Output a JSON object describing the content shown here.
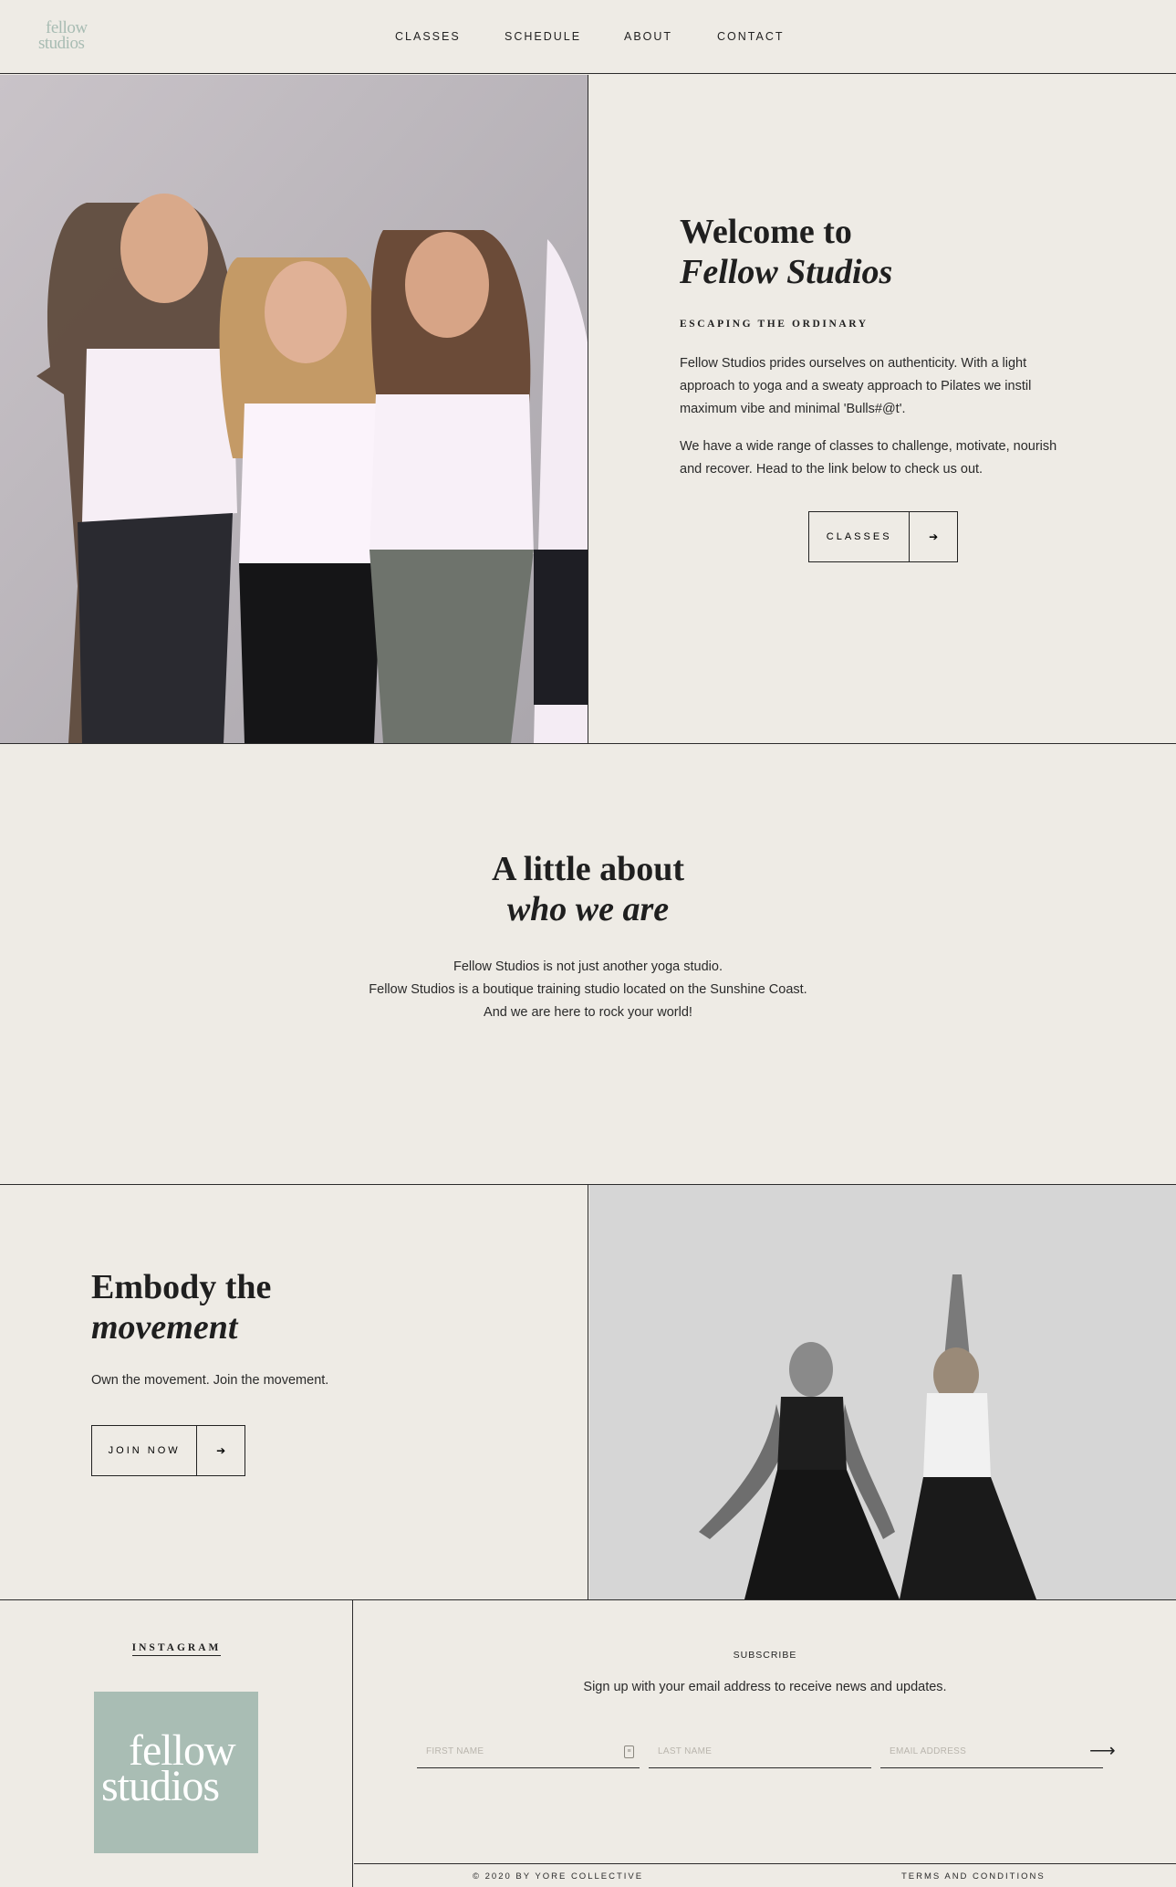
{
  "header": {
    "logo_line1": "fellow",
    "logo_line2": "studios",
    "nav": [
      "CLASSES",
      "SCHEDULE",
      "ABOUT",
      "CONTACT"
    ]
  },
  "hero": {
    "title_line1": "Welcome to",
    "title_line2": "Fellow Studios",
    "eyebrow": "ESCAPING THE ORDINARY",
    "para1": "Fellow Studios prides ourselves on authenticity. With a light approach to yoga and a sweaty approach to Pilates we instil maximum vibe and minimal 'Bulls#@t'.",
    "para2": "We have a wide range of classes to challenge, motivate, nourish and recover. Head to the link below to check us out.",
    "button_label": "CLASSES",
    "button_arrow": "➔"
  },
  "about": {
    "title_line1": "A little about",
    "title_line2": "who we are",
    "lines": [
      "Fellow Studios is not just another yoga studio.",
      "Fellow Studios is a boutique training studio located on the Sunshine Coast.",
      "And we are here to rock your world!"
    ]
  },
  "embody": {
    "title_line1": "Embody the",
    "title_line2": "movement",
    "text": "Own the movement. Join the movement.",
    "button_label": "JOIN NOW",
    "button_arrow": "➔"
  },
  "instagram": {
    "title": "INSTAGRAM",
    "tile_line1": "fellow",
    "tile_line2": "studios"
  },
  "subscribe": {
    "title": "SUBSCRIBE",
    "text": "Sign up with your email address to receive news and updates.",
    "first_name_placeholder": "FIRST NAME",
    "last_name_placeholder": "LAST NAME",
    "email_placeholder": "EMAIL ADDRESS",
    "submit_arrow": "⟶"
  },
  "legal": {
    "copyright": "© 2020 BY YORE COLLECTIVE",
    "terms": "TERMS AND CONDITIONS"
  }
}
